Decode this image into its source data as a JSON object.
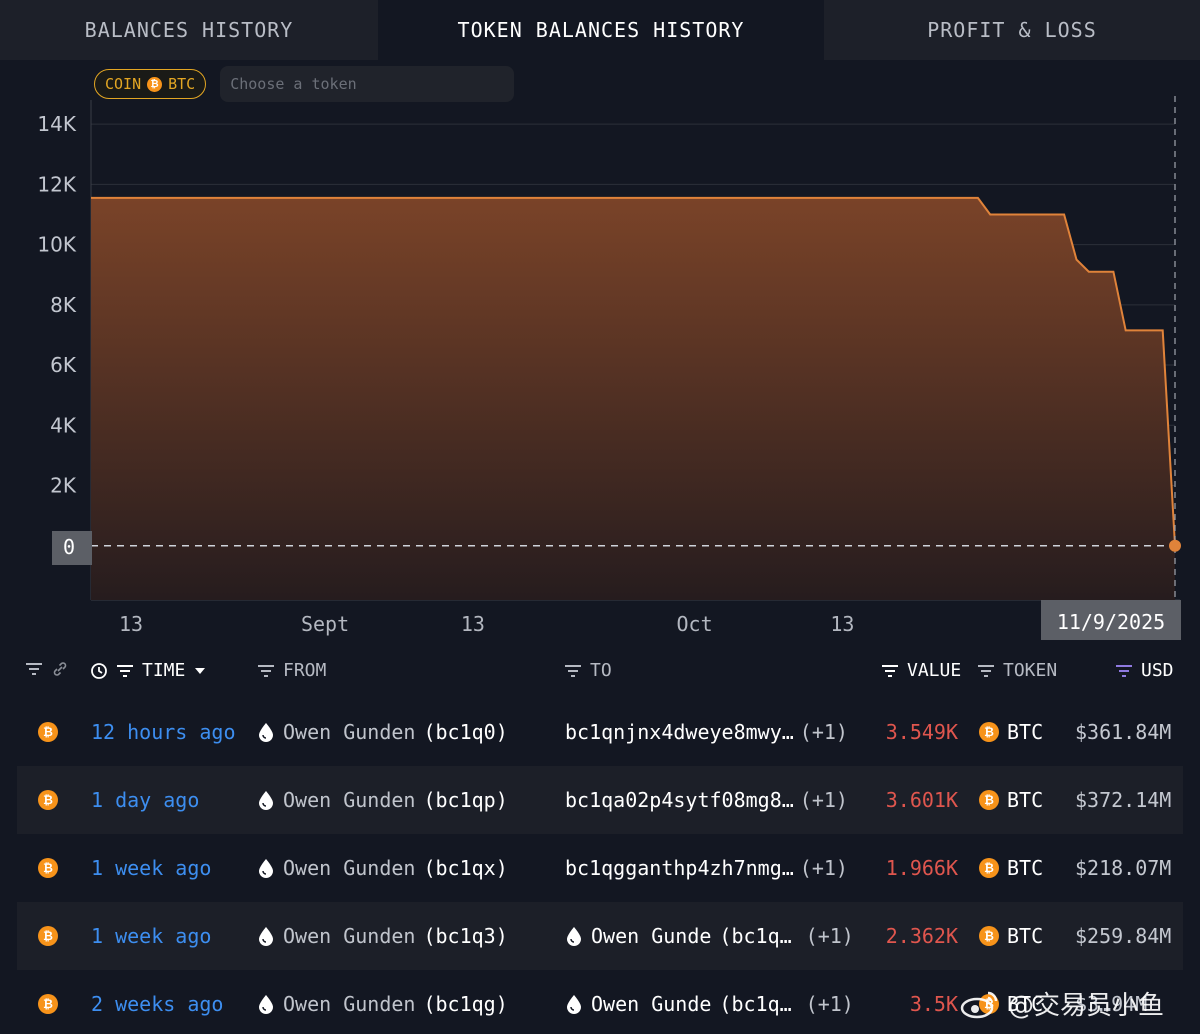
{
  "tabs": [
    {
      "label": "BALANCES HISTORY",
      "active": false
    },
    {
      "label": "TOKEN BALANCES HISTORY",
      "active": true
    },
    {
      "label": "PROFIT & LOSS",
      "active": false
    }
  ],
  "filters": {
    "coin_label": "COIN",
    "coin_symbol": "BTC",
    "token_placeholder": "Choose a token"
  },
  "chart_data": {
    "type": "area",
    "y_ticks": [
      "14K",
      "12K",
      "10K",
      "8K",
      "6K",
      "4K",
      "2K",
      "0"
    ],
    "x_ticks": [
      "13",
      "Sept",
      "13",
      "Oct",
      "13"
    ],
    "ylim": [
      -1800,
      14800
    ],
    "xlim": [
      "2025-08-13",
      "2025-11-09"
    ],
    "hover_label": "11/9/2025",
    "color": "#e0833a",
    "series": [
      {
        "x": [
          "2025-08-13",
          "2025-10-24",
          "2025-10-25",
          "2025-10-31",
          "2025-11-01",
          "2025-11-02",
          "2025-11-04",
          "2025-11-05",
          "2025-11-08",
          "2025-11-09"
        ],
        "values": [
          11550,
          11550,
          11000,
          11000,
          9500,
          9100,
          9100,
          7150,
          7150,
          0
        ]
      }
    ]
  },
  "table": {
    "headers": {
      "time": "TIME",
      "from": "FROM",
      "to": "TO",
      "value": "VALUE",
      "token": "TOKEN",
      "usd": "USD"
    },
    "rows": [
      {
        "time": "12 hours ago",
        "from_name": "Owen Gunden",
        "from_addr": "(bc1q0)",
        "to": "bc1qnjnx4dweye8mwy…",
        "to_extra": "(+1)",
        "value": "3.549K",
        "token": "BTC",
        "usd": "$361.84M"
      },
      {
        "time": "1 day ago",
        "from_name": "Owen Gunden",
        "from_addr": "(bc1qp)",
        "to": "bc1qa02p4sytf08mg8…",
        "to_extra": "(+1)",
        "value": "3.601K",
        "token": "BTC",
        "usd": "$372.14M"
      },
      {
        "time": "1 week ago",
        "from_name": "Owen Gunden",
        "from_addr": "(bc1qx)",
        "to": "bc1qgganthp4zh7nmg…",
        "to_extra": "(+1)",
        "value": "1.966K",
        "token": "BTC",
        "usd": "$218.07M"
      },
      {
        "time": "1 week ago",
        "from_name": "Owen Gunden",
        "from_addr": "(bc1q3)",
        "to_name": "Owen Gunde",
        "to_addr": "(bc1q…",
        "to_extra": "(+1)",
        "value": "2.362K",
        "token": "BTC",
        "usd": "$259.84M"
      },
      {
        "time": "2 weeks ago",
        "from_name": "Owen Gunden",
        "from_addr": "(bc1qg)",
        "to_name": "Owen Gunde",
        "to_addr": "(bc1q…",
        "to_extra": "(+1)",
        "value": "3.5K",
        "token": "BTC",
        "usd": "$3…94M"
      }
    ]
  },
  "watermark": "@交易员小鱼"
}
